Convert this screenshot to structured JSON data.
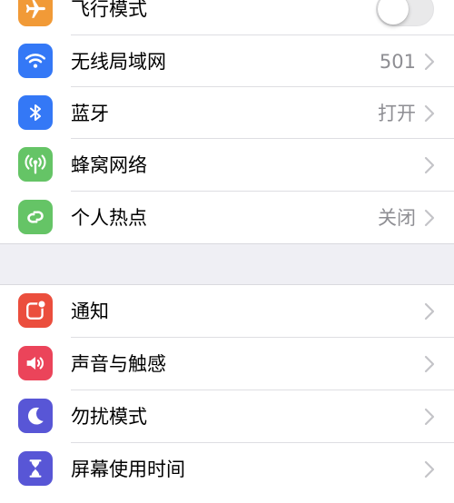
{
  "colors": {
    "airplane": "#f19a37",
    "wifi": "#3478f6",
    "bluetooth": "#3478f6",
    "cellular": "#65c466",
    "hotspot": "#65c466",
    "notifications": "#eb4e3d",
    "sounds": "#eb445a",
    "dnd": "#5856d6",
    "screentime": "#5856d6",
    "value_gray": "#8e8e93",
    "background": "#efeff4"
  },
  "group1": {
    "airplane": {
      "label": "飞行模式",
      "icon": "airplane-icon",
      "toggle_on": false
    },
    "wifi": {
      "label": "无线局域网",
      "value": "501",
      "icon": "wifi-icon"
    },
    "bluetooth": {
      "label": "蓝牙",
      "value": "打开",
      "icon": "bluetooth-icon"
    },
    "cellular": {
      "label": "蜂窝网络",
      "icon": "antenna-icon"
    },
    "hotspot": {
      "label": "个人热点",
      "value": "关闭",
      "icon": "link-icon"
    }
  },
  "group2": {
    "notifications": {
      "label": "通知",
      "icon": "notification-icon"
    },
    "sounds": {
      "label": "声音与触感",
      "icon": "speaker-icon"
    },
    "dnd": {
      "label": "勿扰模式",
      "icon": "moon-icon"
    },
    "screentime": {
      "label": "屏幕使用时间",
      "icon": "hourglass-icon"
    }
  }
}
